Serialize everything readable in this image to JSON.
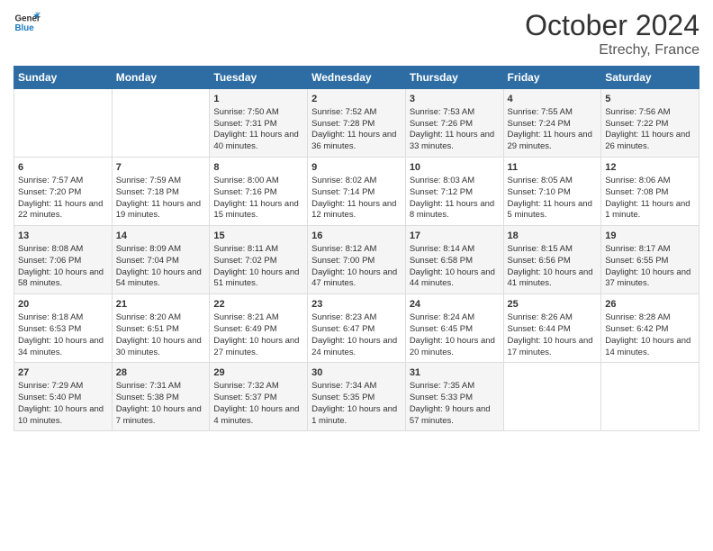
{
  "header": {
    "logo_line1": "General",
    "logo_line2": "Blue",
    "title": "October 2024",
    "subtitle": "Etrechy, France"
  },
  "days_of_week": [
    "Sunday",
    "Monday",
    "Tuesday",
    "Wednesday",
    "Thursday",
    "Friday",
    "Saturday"
  ],
  "weeks": [
    [
      {
        "day": "",
        "content": ""
      },
      {
        "day": "",
        "content": ""
      },
      {
        "day": "1",
        "content": "Sunrise: 7:50 AM\nSunset: 7:31 PM\nDaylight: 11 hours and 40 minutes."
      },
      {
        "day": "2",
        "content": "Sunrise: 7:52 AM\nSunset: 7:28 PM\nDaylight: 11 hours and 36 minutes."
      },
      {
        "day": "3",
        "content": "Sunrise: 7:53 AM\nSunset: 7:26 PM\nDaylight: 11 hours and 33 minutes."
      },
      {
        "day": "4",
        "content": "Sunrise: 7:55 AM\nSunset: 7:24 PM\nDaylight: 11 hours and 29 minutes."
      },
      {
        "day": "5",
        "content": "Sunrise: 7:56 AM\nSunset: 7:22 PM\nDaylight: 11 hours and 26 minutes."
      }
    ],
    [
      {
        "day": "6",
        "content": "Sunrise: 7:57 AM\nSunset: 7:20 PM\nDaylight: 11 hours and 22 minutes."
      },
      {
        "day": "7",
        "content": "Sunrise: 7:59 AM\nSunset: 7:18 PM\nDaylight: 11 hours and 19 minutes."
      },
      {
        "day": "8",
        "content": "Sunrise: 8:00 AM\nSunset: 7:16 PM\nDaylight: 11 hours and 15 minutes."
      },
      {
        "day": "9",
        "content": "Sunrise: 8:02 AM\nSunset: 7:14 PM\nDaylight: 11 hours and 12 minutes."
      },
      {
        "day": "10",
        "content": "Sunrise: 8:03 AM\nSunset: 7:12 PM\nDaylight: 11 hours and 8 minutes."
      },
      {
        "day": "11",
        "content": "Sunrise: 8:05 AM\nSunset: 7:10 PM\nDaylight: 11 hours and 5 minutes."
      },
      {
        "day": "12",
        "content": "Sunrise: 8:06 AM\nSunset: 7:08 PM\nDaylight: 11 hours and 1 minute."
      }
    ],
    [
      {
        "day": "13",
        "content": "Sunrise: 8:08 AM\nSunset: 7:06 PM\nDaylight: 10 hours and 58 minutes."
      },
      {
        "day": "14",
        "content": "Sunrise: 8:09 AM\nSunset: 7:04 PM\nDaylight: 10 hours and 54 minutes."
      },
      {
        "day": "15",
        "content": "Sunrise: 8:11 AM\nSunset: 7:02 PM\nDaylight: 10 hours and 51 minutes."
      },
      {
        "day": "16",
        "content": "Sunrise: 8:12 AM\nSunset: 7:00 PM\nDaylight: 10 hours and 47 minutes."
      },
      {
        "day": "17",
        "content": "Sunrise: 8:14 AM\nSunset: 6:58 PM\nDaylight: 10 hours and 44 minutes."
      },
      {
        "day": "18",
        "content": "Sunrise: 8:15 AM\nSunset: 6:56 PM\nDaylight: 10 hours and 41 minutes."
      },
      {
        "day": "19",
        "content": "Sunrise: 8:17 AM\nSunset: 6:55 PM\nDaylight: 10 hours and 37 minutes."
      }
    ],
    [
      {
        "day": "20",
        "content": "Sunrise: 8:18 AM\nSunset: 6:53 PM\nDaylight: 10 hours and 34 minutes."
      },
      {
        "day": "21",
        "content": "Sunrise: 8:20 AM\nSunset: 6:51 PM\nDaylight: 10 hours and 30 minutes."
      },
      {
        "day": "22",
        "content": "Sunrise: 8:21 AM\nSunset: 6:49 PM\nDaylight: 10 hours and 27 minutes."
      },
      {
        "day": "23",
        "content": "Sunrise: 8:23 AM\nSunset: 6:47 PM\nDaylight: 10 hours and 24 minutes."
      },
      {
        "day": "24",
        "content": "Sunrise: 8:24 AM\nSunset: 6:45 PM\nDaylight: 10 hours and 20 minutes."
      },
      {
        "day": "25",
        "content": "Sunrise: 8:26 AM\nSunset: 6:44 PM\nDaylight: 10 hours and 17 minutes."
      },
      {
        "day": "26",
        "content": "Sunrise: 8:28 AM\nSunset: 6:42 PM\nDaylight: 10 hours and 14 minutes."
      }
    ],
    [
      {
        "day": "27",
        "content": "Sunrise: 7:29 AM\nSunset: 5:40 PM\nDaylight: 10 hours and 10 minutes."
      },
      {
        "day": "28",
        "content": "Sunrise: 7:31 AM\nSunset: 5:38 PM\nDaylight: 10 hours and 7 minutes."
      },
      {
        "day": "29",
        "content": "Sunrise: 7:32 AM\nSunset: 5:37 PM\nDaylight: 10 hours and 4 minutes."
      },
      {
        "day": "30",
        "content": "Sunrise: 7:34 AM\nSunset: 5:35 PM\nDaylight: 10 hours and 1 minute."
      },
      {
        "day": "31",
        "content": "Sunrise: 7:35 AM\nSunset: 5:33 PM\nDaylight: 9 hours and 57 minutes."
      },
      {
        "day": "",
        "content": ""
      },
      {
        "day": "",
        "content": ""
      }
    ]
  ]
}
